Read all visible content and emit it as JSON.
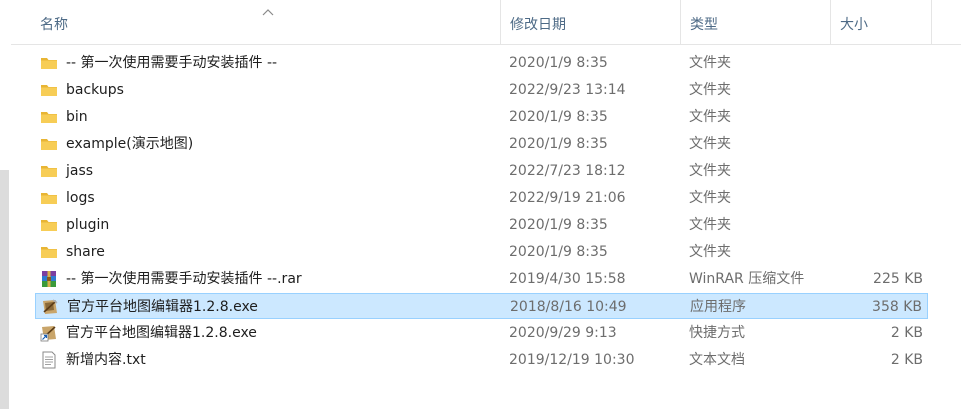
{
  "columns": {
    "name": "名称",
    "date": "修改日期",
    "type": "类型",
    "size": "大小"
  },
  "files": [
    {
      "name": "-- 第一次使用需要手动安装插件 --",
      "date": "2020/1/9 8:35",
      "type": "文件夹",
      "size": "",
      "icon": "folder-icon"
    },
    {
      "name": "backups",
      "date": "2022/9/23 13:14",
      "type": "文件夹",
      "size": "",
      "icon": "folder-icon"
    },
    {
      "name": "bin",
      "date": "2020/1/9 8:35",
      "type": "文件夹",
      "size": "",
      "icon": "folder-icon"
    },
    {
      "name": "example(演示地图)",
      "date": "2020/1/9 8:35",
      "type": "文件夹",
      "size": "",
      "icon": "folder-icon"
    },
    {
      "name": "jass",
      "date": "2022/7/23 18:12",
      "type": "文件夹",
      "size": "",
      "icon": "folder-icon"
    },
    {
      "name": "logs",
      "date": "2022/9/19 21:06",
      "type": "文件夹",
      "size": "",
      "icon": "folder-icon"
    },
    {
      "name": "plugin",
      "date": "2020/1/9 8:35",
      "type": "文件夹",
      "size": "",
      "icon": "folder-icon"
    },
    {
      "name": "share",
      "date": "2020/1/9 8:35",
      "type": "文件夹",
      "size": "",
      "icon": "folder-icon"
    },
    {
      "name": "-- 第一次使用需要手动安装插件 --.rar",
      "date": "2019/4/30 15:58",
      "type": "WinRAR 压缩文件",
      "size": "225 KB",
      "icon": "winrar-archive-icon"
    },
    {
      "name": "官方平台地图编辑器1.2.8.exe",
      "date": "2018/8/16 10:49",
      "type": "应用程序",
      "size": "358 KB",
      "icon": "map-editor-exe-icon",
      "selected": true
    },
    {
      "name": "官方平台地图编辑器1.2.8.exe",
      "date": "2020/9/29 9:13",
      "type": "快捷方式",
      "size": "2 KB",
      "icon": "shortcut-icon"
    },
    {
      "name": "新增内容.txt",
      "date": "2019/12/19 10:30",
      "type": "文本文档",
      "size": "2 KB",
      "icon": "text-document-icon"
    }
  ],
  "colors": {
    "selection_bg": "#cce8ff",
    "selection_border": "#99d1ff",
    "folder": "#f7c948",
    "header_text": "#4d6a86"
  }
}
